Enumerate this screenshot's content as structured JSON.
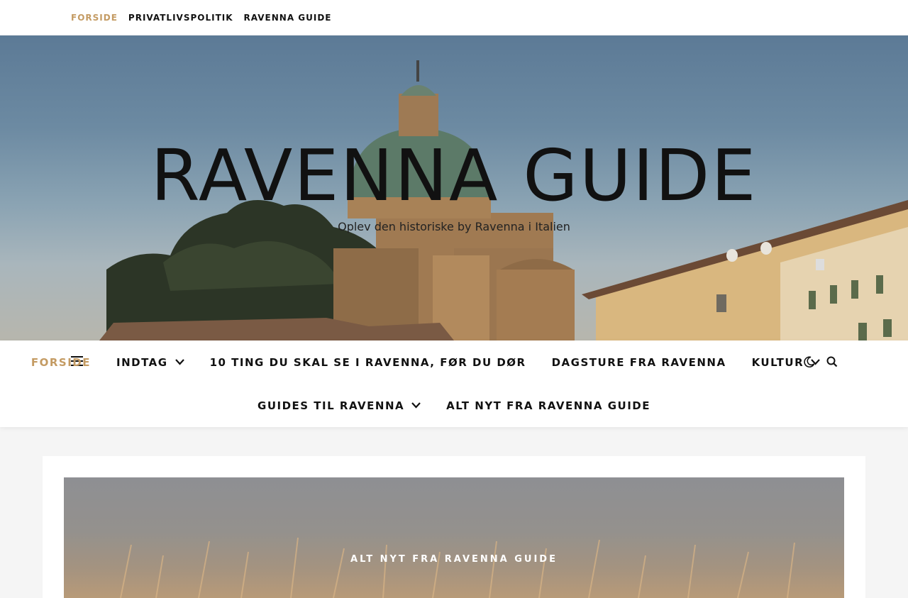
{
  "topbar": {
    "links": [
      "FORSIDE",
      "PRIVATLIVSPOLITIK",
      "RAVENNA GUIDE"
    ]
  },
  "hero": {
    "title": "RAVENNA GUIDE",
    "tagline": "Oplev den historiske by Ravenna i Italien"
  },
  "nav": {
    "row1": [
      "FORSIDE",
      "INDTAG",
      "10 TING DU SKAL SE I RAVENNA, FØR DU DØR",
      "DAGSTURE FRA RAVENNA",
      "KULTUR"
    ],
    "row2": [
      "GUIDES TIL RAVENNA",
      "ALT NYT FRA RAVENNA GUIDE"
    ],
    "menu_icon": "hamburger-icon",
    "theme_icon": "moon-icon",
    "search_icon": "search-icon"
  },
  "featured": {
    "category": "ALT NYT FRA RAVENNA GUIDE"
  },
  "colors": {
    "accent": "#c49b63",
    "text": "#111111",
    "background": "#f5f5f5"
  }
}
